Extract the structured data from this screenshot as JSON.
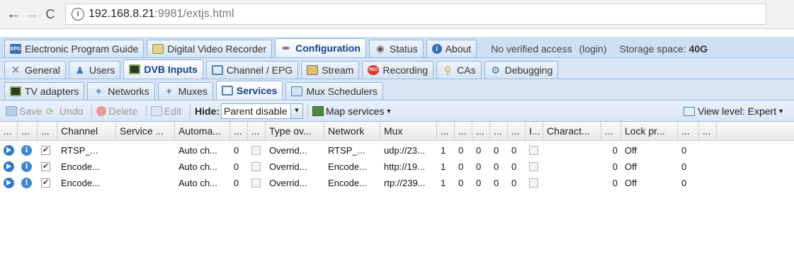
{
  "browser": {
    "url_host": "192.168.8.21",
    "url_path": ":9981/extjs.html"
  },
  "main_tabs": [
    {
      "label": "Electronic Program Guide",
      "icon": "epg-icon",
      "active": false
    },
    {
      "label": "Digital Video Recorder",
      "icon": "dvr-icon",
      "active": false
    },
    {
      "label": "Configuration",
      "icon": "wrench-icon",
      "active": true
    },
    {
      "label": "Status",
      "icon": "eye-icon",
      "active": false
    },
    {
      "label": "About",
      "icon": "info-icon",
      "active": false
    }
  ],
  "header_status": {
    "access": "No verified access",
    "login": "(login)",
    "storage_label": "Storage space:",
    "storage_value": "40G"
  },
  "config_tabs": [
    {
      "label": "General",
      "icon": "tools-icon",
      "active": false
    },
    {
      "label": "Users",
      "icon": "users-icon",
      "active": false
    },
    {
      "label": "DVB Inputs",
      "icon": "tv-card-icon",
      "active": true
    },
    {
      "label": "Channel / EPG",
      "icon": "tv-icon",
      "active": false
    },
    {
      "label": "Stream",
      "icon": "stream-icon",
      "active": false
    },
    {
      "label": "Recording",
      "icon": "rec-icon",
      "active": false
    },
    {
      "label": "CAs",
      "icon": "key-icon",
      "active": false
    },
    {
      "label": "Debugging",
      "icon": "gears-icon",
      "active": false
    }
  ],
  "dvb_tabs": [
    {
      "label": "TV adapters",
      "icon": "adapter-icon",
      "active": false
    },
    {
      "label": "Networks",
      "icon": "antenna-icon",
      "active": false
    },
    {
      "label": "Muxes",
      "icon": "satellite-icon",
      "active": false
    },
    {
      "label": "Services",
      "icon": "services-icon",
      "active": true
    },
    {
      "label": "Mux Schedulers",
      "icon": "scheduler-icon",
      "active": false
    }
  ],
  "toolbar": {
    "save": "Save",
    "undo": "Undo",
    "delete": "Delete",
    "edit": "Edit",
    "hide_label": "Hide:",
    "hide_value": "Parent disable",
    "map_services": "Map services",
    "view_level": "View level: Expert"
  },
  "columns": [
    "...",
    "...",
    "...",
    "Channel",
    "Service ...",
    "Automa...",
    "...",
    "...",
    "Type ov...",
    "Network",
    "Mux",
    "...",
    "...",
    "...",
    "...",
    "...",
    "I...",
    "Charact...",
    "...",
    "Lock pr...",
    "...",
    "..."
  ],
  "rows": [
    {
      "enabled": true,
      "channel": "RTSP_...",
      "service": "",
      "auto": "Auto ch...",
      "prio": "0",
      "type": "Overrid...",
      "network": "RTSP_...",
      "mux": "udp://23...",
      "c1": "1",
      "c2": "0",
      "c3": "0",
      "c4": "0",
      "c5": "0",
      "charact": "",
      "c6": "0",
      "lock": "Off",
      "c7": "0"
    },
    {
      "enabled": true,
      "channel": "Encode...",
      "service": "",
      "auto": "Auto ch...",
      "prio": "0",
      "type": "Overrid...",
      "network": "Encode...",
      "mux": "http://19...",
      "c1": "1",
      "c2": "0",
      "c3": "0",
      "c4": "0",
      "c5": "0",
      "charact": "",
      "c6": "0",
      "lock": "Off",
      "c7": "0"
    },
    {
      "enabled": true,
      "channel": "Encode...",
      "service": "",
      "auto": "Auto ch...",
      "prio": "0",
      "type": "Overrid...",
      "network": "Encode...",
      "mux": "rtp://239...",
      "c1": "1",
      "c2": "0",
      "c3": "0",
      "c4": "0",
      "c5": "0",
      "charact": "",
      "c6": "0",
      "lock": "Off",
      "c7": "0"
    }
  ]
}
